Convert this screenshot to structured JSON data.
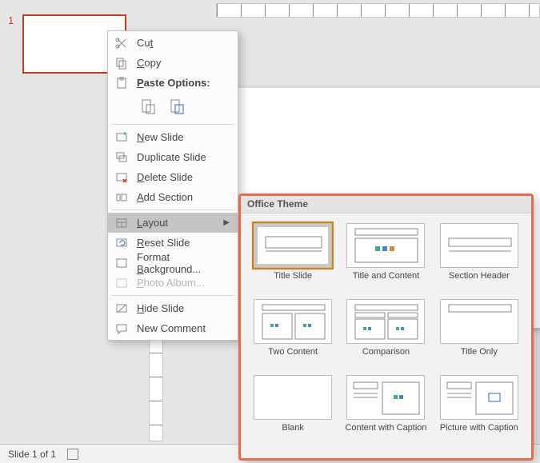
{
  "status": {
    "text": "Slide 1 of 1"
  },
  "slide_panel": {
    "number": "1"
  },
  "context_menu": {
    "cut": "Cut",
    "copy": "Copy",
    "paste_options": "Paste Options:",
    "new_slide": "New Slide",
    "duplicate_slide": "Duplicate Slide",
    "delete_slide": "Delete Slide",
    "add_section": "Add Section",
    "layout": "Layout",
    "reset_slide": "Reset Slide",
    "format_background": "Format Background...",
    "photo_album": "Photo Album...",
    "hide_slide": "Hide Slide",
    "new_comment": "New Comment"
  },
  "flyout": {
    "header": "Office Theme",
    "layouts": {
      "title_slide": "Title Slide",
      "title_content": "Title and Content",
      "section_header": "Section Header",
      "two_content": "Two Content",
      "comparison": "Comparison",
      "title_only": "Title Only",
      "blank": "Blank",
      "content_caption": "Content with Caption",
      "picture_caption": "Picture with Caption"
    }
  }
}
